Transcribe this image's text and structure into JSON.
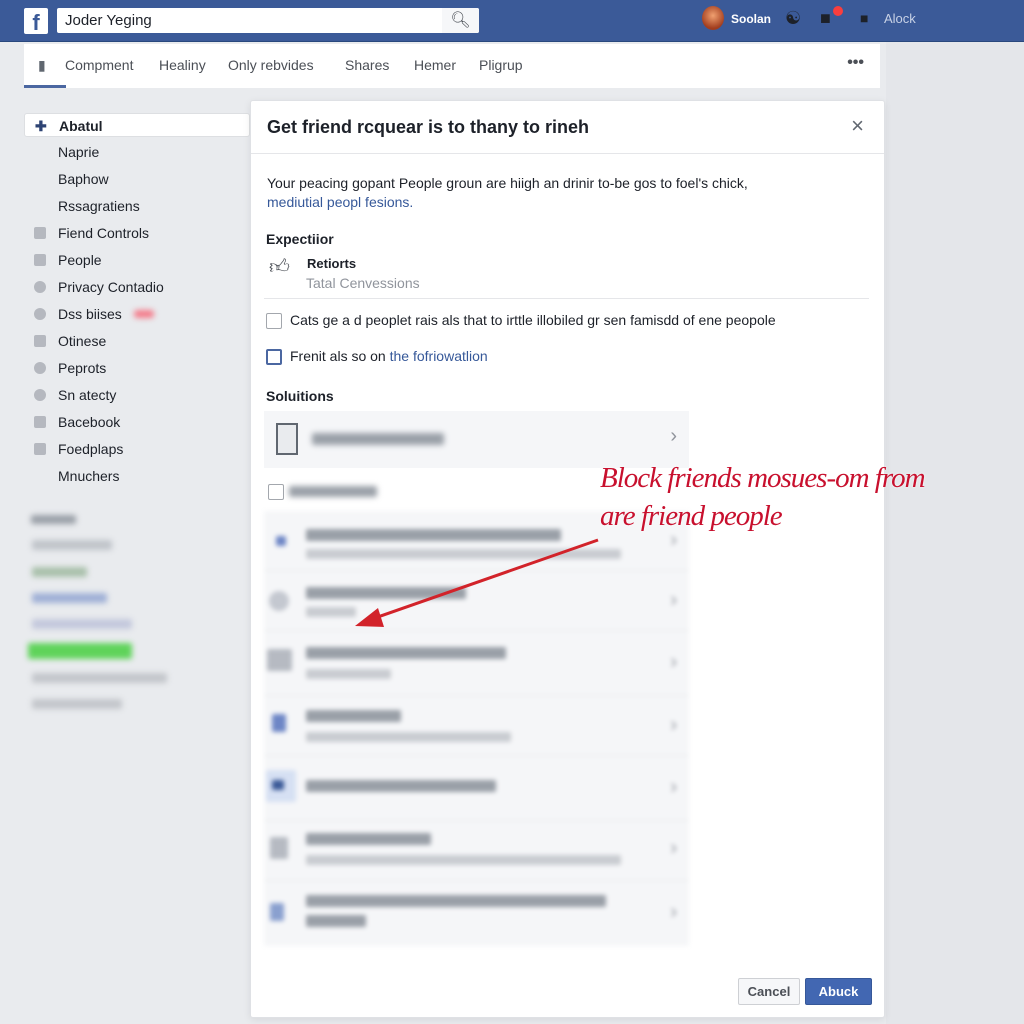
{
  "header": {
    "search_value": "Joder Yeging",
    "user_name": "Soolan",
    "block_label": "Alock",
    "notification_color": "#fa3e3e",
    "brand_color": "#3b5a98"
  },
  "tabs": [
    "Compment",
    "Healiny",
    "Only rebvides",
    "Shares",
    "Hemer",
    "Pligrup"
  ],
  "more_label": "•••",
  "sidebar": {
    "items": [
      {
        "label": "Abatul",
        "icon": "plane-icon",
        "active": true
      },
      {
        "label": "Naprie"
      },
      {
        "label": "Baphow"
      },
      {
        "label": "Rssagratiens"
      },
      {
        "label": "Fiend Controls",
        "icon": "person-icon"
      },
      {
        "label": "People",
        "icon": "folder-icon"
      },
      {
        "label": "Privacy Contadio",
        "icon": "circle-icon"
      },
      {
        "label": "Dss biises",
        "icon": "search-icon"
      },
      {
        "label": "Otinese",
        "icon": "box-icon"
      },
      {
        "label": "Peprots",
        "icon": "refresh-icon"
      },
      {
        "label": "Sn atecty",
        "icon": "loop-icon"
      },
      {
        "label": "Bacebook",
        "icon": "group-icon"
      },
      {
        "label": "Foedplaps",
        "icon": "feed-icon"
      },
      {
        "label": "Mnuchers"
      }
    ]
  },
  "dialog": {
    "title": "Get friend rcquear is to thany to rineh",
    "close": "×",
    "desc": "Your peacing gopant People groun are hiigh an drinir to-be gos to foel's chick,",
    "desc_link": "mediutial peopl fesions.",
    "section1": "Expectiior",
    "item_title": "Retiorts",
    "item_sub": "Tatal Cenvessions",
    "check1": "Cats ge a d peoplet rais als that to irttle illobiled gr sen famisdd of ene peopole",
    "check2_text": "Frenit als so on ",
    "check2_link": "the fofriowatlion",
    "section2": "Soluitions",
    "cancel": "Cancel",
    "confirm": "Abuck"
  },
  "annotation": {
    "line1": "Block friends mosues-om from",
    "line2": "are friend people",
    "color": "#c8102e"
  }
}
